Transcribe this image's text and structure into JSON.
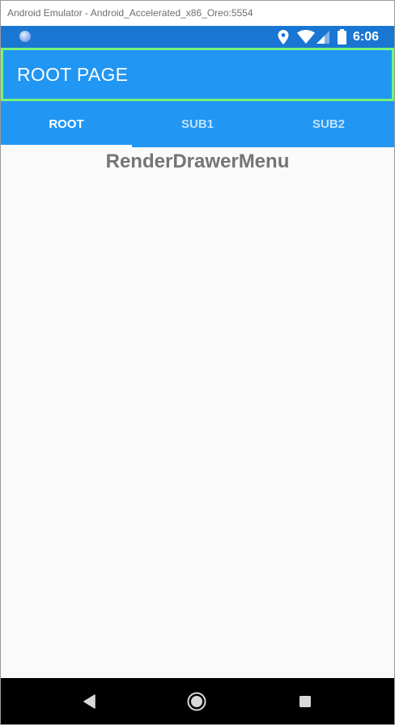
{
  "window": {
    "title": "Android Emulator - Android_Accelerated_x86_Oreo:5554"
  },
  "status_bar": {
    "time": "6:06",
    "icons": [
      "notification-dot-icon",
      "location-icon",
      "wifi-icon",
      "signal-icon",
      "battery-icon"
    ],
    "color": "#1976D2"
  },
  "app_bar": {
    "title": "ROOT PAGE",
    "color": "#2196F3",
    "highlight_border": "#76f57a"
  },
  "tabs": [
    {
      "label": "ROOT",
      "active": true
    },
    {
      "label": "SUB1",
      "active": false
    },
    {
      "label": "SUB2",
      "active": false
    }
  ],
  "content": {
    "heading": "RenderDrawerMenu",
    "background": "#fafafa"
  },
  "nav_bar": {
    "buttons": [
      "back-icon",
      "home-icon",
      "recents-icon"
    ]
  }
}
